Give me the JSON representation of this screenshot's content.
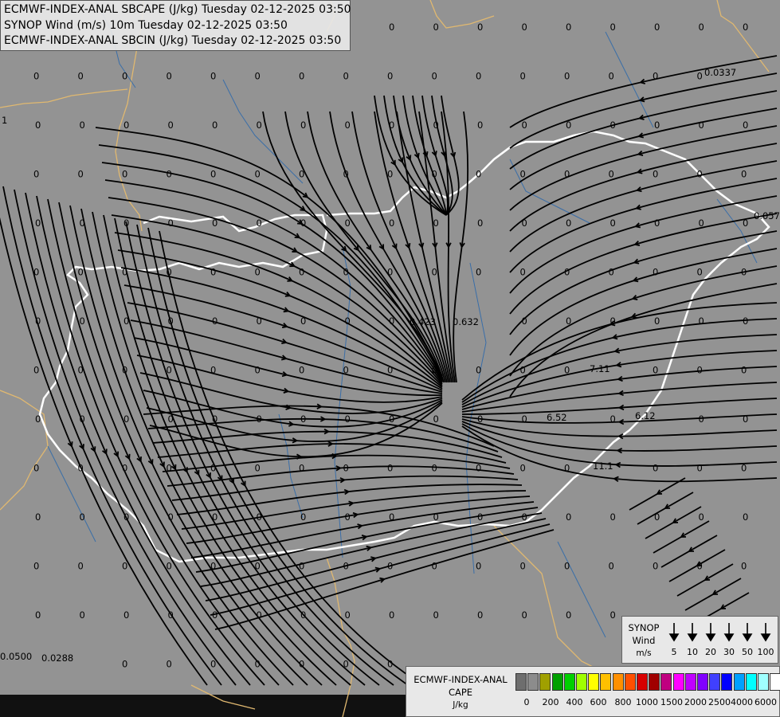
{
  "titles": [
    "ECMWF-INDEX-ANAL SBCAPE (J/kg) Tuesday 02-12-2025 03:50",
    "SYNOP Wind (m/s) 10m Tuesday 02-12-2025 03:50",
    "ECMWF-INDEX-ANAL SBCIN (J/kg) Tuesday 02-12-2025 03:50"
  ],
  "synop_legend": {
    "title_lines": [
      "SYNOP",
      "Wind",
      "m/s"
    ],
    "speeds": [
      "5",
      "10",
      "20",
      "30",
      "50",
      "100"
    ]
  },
  "cape_legend": {
    "title_lines": [
      "ECMWF-INDEX-ANAL",
      "CAPE",
      "J/kg"
    ],
    "swatch_colors": [
      "#6e6e6e",
      "#8c8c8c",
      "#a0a000",
      "#00a000",
      "#00d000",
      "#a0ff00",
      "#ffff00",
      "#ffc000",
      "#ff9000",
      "#ff5000",
      "#d80000",
      "#a00000",
      "#c00080",
      "#ff00ff",
      "#c000ff",
      "#8000ff",
      "#4040ff",
      "#0000ff",
      "#00a0ff",
      "#00ffff",
      "#a0ffff",
      "#ffffff"
    ],
    "ticks": [
      "0",
      "200",
      "400",
      "600",
      "800",
      "1000",
      "1500",
      "2000",
      "2500",
      "4000",
      "6000"
    ]
  },
  "colors": {
    "background": "#939393",
    "border": "#ffffff",
    "secondary_border": "#e0b870",
    "rivers": "#3a6ea8",
    "streamlines": "#000000"
  },
  "grid_values": {
    "zero": "0",
    "nonzero": [
      "1",
      "0.0337",
      "0.057",
      "0.423",
      "0.632",
      "7.11",
      "6.52",
      "6.12",
      "11.1",
      "0.0500",
      "0.0288"
    ]
  }
}
